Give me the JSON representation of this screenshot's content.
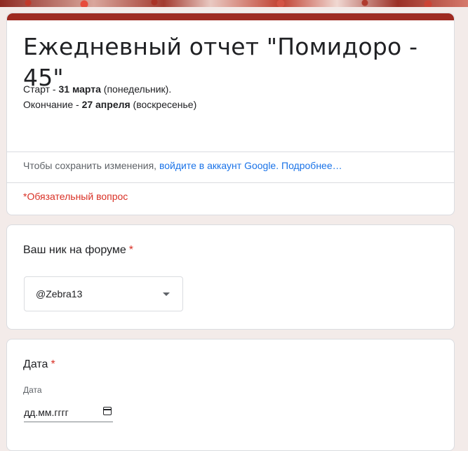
{
  "form": {
    "title": "Ежедневный отчет \"Помидоро - 45\"",
    "desc": {
      "start_prefix": "Старт - ",
      "start_date": "31 марта",
      "start_suffix": " (понедельник).",
      "end_prefix": "Окончание - ",
      "end_date": "27 апреля",
      "end_suffix": " (воскресенье)"
    },
    "signin": {
      "text": "Чтобы сохранить изменения, ",
      "link": "войдите в аккаунт Google.",
      "more": "Подробнее…"
    },
    "required_note": "*Обязательный вопрос",
    "accent_color": "#9e2a21"
  },
  "questions": {
    "nick": {
      "label": "Ваш ник на форуме",
      "required_mark": "*",
      "selected": "@Zebra13"
    },
    "date": {
      "label": "Дата",
      "required_mark": "*",
      "sub_label": "Дата",
      "placeholder": "дд.мм.гггг"
    }
  }
}
